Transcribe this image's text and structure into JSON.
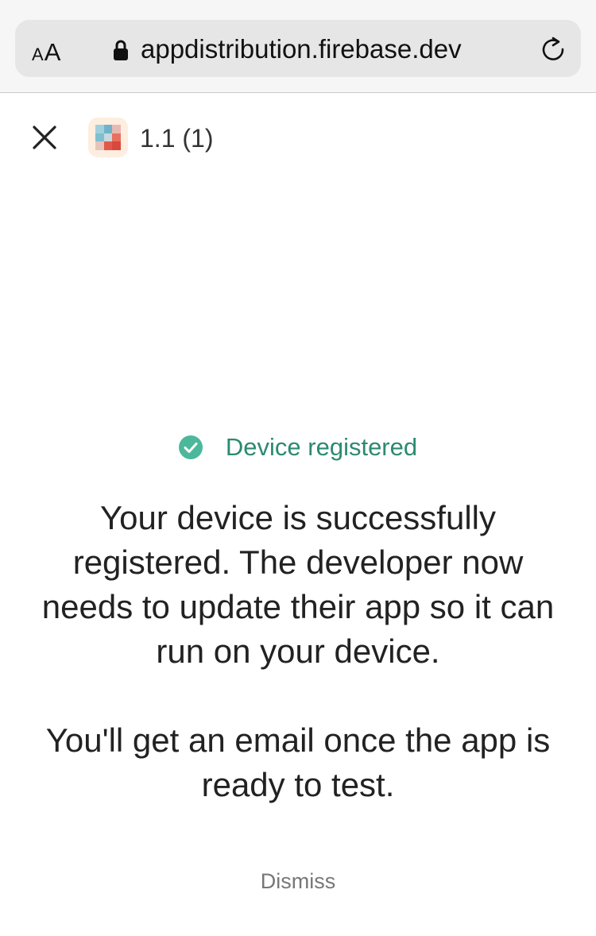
{
  "browser": {
    "text_size_small": "A",
    "text_size_large": "A",
    "url": "appdistribution.firebase.dev",
    "icons": [
      "lock-icon",
      "reload-icon"
    ]
  },
  "header": {
    "version": "1.1 (1)",
    "icons": [
      "close-icon",
      "app-icon"
    ]
  },
  "status": {
    "text": "Device registered",
    "color": "#2b8a72",
    "icon": "check-circle-icon"
  },
  "message": {
    "paragraph1": "Your device is successfully registered. The developer now needs to update their app so it can run on your device.",
    "paragraph2": "You'll get an email once the app is ready to test."
  },
  "actions": {
    "dismiss_label": "Dismiss"
  }
}
